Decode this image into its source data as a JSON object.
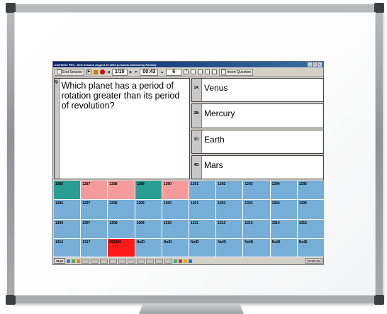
{
  "window": {
    "title": "InterWrite PRS - New Session August 23 2004 (Lessons Astronomy Review)",
    "buttons": [
      "_",
      "□",
      "x"
    ]
  },
  "toolbar": {
    "end_session_label": "End Session",
    "question_counter": "1/15",
    "timer": "00:43",
    "responses_count": "6",
    "insert_question_label": "Insert Question"
  },
  "question": {
    "tag": "Q:",
    "text": "Which planet has a period of rotation greater than its period of revolution?"
  },
  "answers": [
    {
      "tag": "1A:",
      "text": "Venus"
    },
    {
      "tag": "2B:",
      "text": "Mercury"
    },
    {
      "tag": "3C:",
      "text": "Earth"
    },
    {
      "tag": "4D:",
      "text": "Mars"
    }
  ],
  "status_colors": {
    "teal": "#2a9e94",
    "pink": "#f59b9b",
    "blue": "#77aed8",
    "red": "#ff1a1a"
  },
  "grid_cells": [
    {
      "label": "1286",
      "status": "teal"
    },
    {
      "label": "1287",
      "status": "pink"
    },
    {
      "label": "1288",
      "status": "pink"
    },
    {
      "label": "1289",
      "status": "teal"
    },
    {
      "label": "1290",
      "status": "pink"
    },
    {
      "label": "1291",
      "status": "blue"
    },
    {
      "label": "1292",
      "status": "blue"
    },
    {
      "label": "1293",
      "status": "blue"
    },
    {
      "label": "1294",
      "status": "blue"
    },
    {
      "label": "1295",
      "status": "blue"
    },
    {
      "label": "1296",
      "status": "blue"
    },
    {
      "label": "1297",
      "status": "blue"
    },
    {
      "label": "1298",
      "status": "blue"
    },
    {
      "label": "1299",
      "status": "blue"
    },
    {
      "label": "1300",
      "status": "blue"
    },
    {
      "label": "1301",
      "status": "blue"
    },
    {
      "label": "1302",
      "status": "blue"
    },
    {
      "label": "1303",
      "status": "blue"
    },
    {
      "label": "1304",
      "status": "blue"
    },
    {
      "label": "1305",
      "status": "blue"
    },
    {
      "label": "1306",
      "status": "blue"
    },
    {
      "label": "1307",
      "status": "blue"
    },
    {
      "label": "1308",
      "status": "blue"
    },
    {
      "label": "1309",
      "status": "blue"
    },
    {
      "label": "1310",
      "status": "blue"
    },
    {
      "label": "1311",
      "status": "blue"
    },
    {
      "label": "1312",
      "status": "blue"
    },
    {
      "label": "1313",
      "status": "blue"
    },
    {
      "label": "1314",
      "status": "blue"
    },
    {
      "label": "1315",
      "status": "blue"
    },
    {
      "label": "1316",
      "status": "blue"
    },
    {
      "label": "1317",
      "status": "blue"
    },
    {
      "label": "999999",
      "status": "red"
    },
    {
      "label": "NoID",
      "status": "blue"
    },
    {
      "label": "NoID",
      "status": "blue"
    },
    {
      "label": "NoID",
      "status": "blue"
    },
    {
      "label": "NoID",
      "status": "blue"
    },
    {
      "label": "NoID",
      "status": "blue"
    },
    {
      "label": "NoID",
      "status": "blue"
    },
    {
      "label": "NoID",
      "status": "blue"
    }
  ],
  "taskbar": {
    "start_label": "Start",
    "clock": "10:30 AM"
  }
}
